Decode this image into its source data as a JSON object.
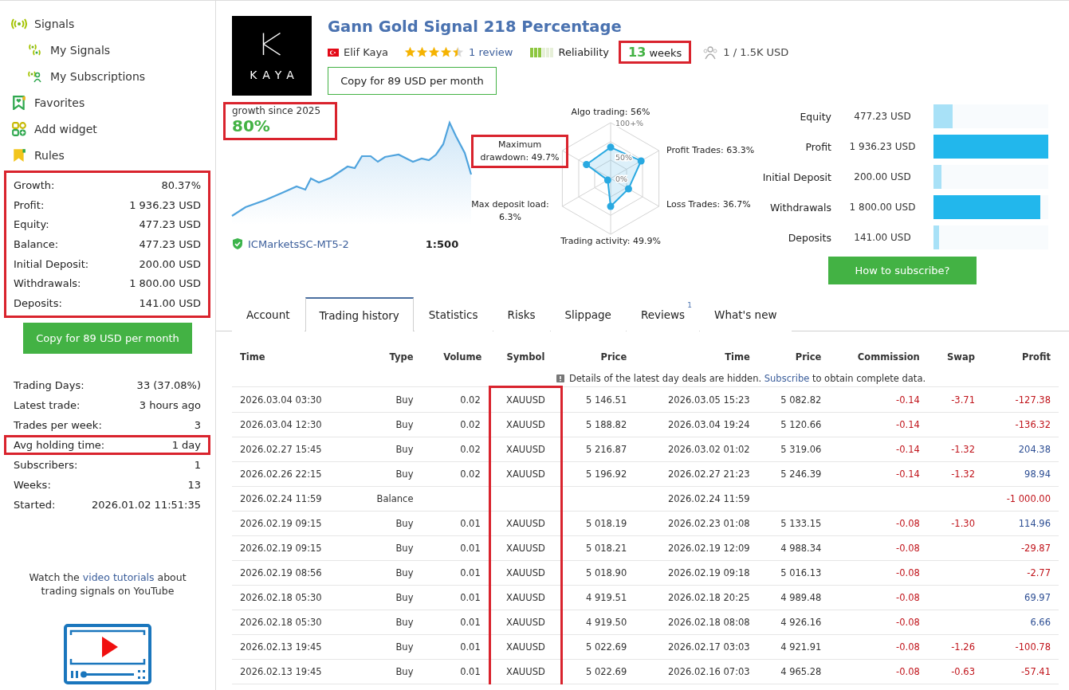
{
  "sidebar": {
    "nav": [
      {
        "label": "Signals",
        "children": [
          {
            "label": "My Signals"
          },
          {
            "label": "My Subscriptions"
          }
        ]
      },
      {
        "label": "Favorites"
      },
      {
        "label": "Add widget"
      },
      {
        "label": "Rules"
      }
    ],
    "stats_highlighted": true,
    "stats": [
      {
        "label": "Growth:",
        "value": "80.37%"
      },
      {
        "label": "Profit:",
        "value": "1 936.23 USD"
      },
      {
        "label": "Equity:",
        "value": "477.23 USD"
      },
      {
        "label": "Balance:",
        "value": "477.23 USD"
      },
      {
        "label": "Initial Deposit:",
        "value": "200.00 USD"
      },
      {
        "label": "Withdrawals:",
        "value": "1 800.00 USD"
      },
      {
        "label": "Deposits:",
        "value": "141.00 USD"
      }
    ],
    "copy_button": "Copy for 89 USD per month",
    "info": [
      {
        "label": "Trading Days:",
        "value": "33 (37.08%)",
        "highlighted": false
      },
      {
        "label": "Latest trade:",
        "value": "3 hours ago",
        "highlighted": false
      },
      {
        "label": "Trades per week:",
        "value": "3",
        "highlighted": false
      },
      {
        "label": "Avg holding time:",
        "value": "1 day",
        "highlighted": true
      },
      {
        "label": "Subscribers:",
        "value": "1",
        "highlighted": false
      },
      {
        "label": "Weeks:",
        "value": "13",
        "highlighted": false
      },
      {
        "label": "Started:",
        "value": "2026.01.02 11:51:35",
        "highlighted": false
      }
    ],
    "tutorial": {
      "before": "Watch the ",
      "link": "video tutorials",
      "after": " about trading signals on YouTube"
    }
  },
  "header": {
    "logo_text": "KAYA",
    "title": "Gann Gold Signal 218 Percentage",
    "author": "Elif Kaya",
    "stars": 4.5,
    "reviews": "1 review",
    "reliability": {
      "label": "Reliability",
      "level": 0.5
    },
    "weeks": {
      "value": "13",
      "unit": "weeks",
      "highlighted": true
    },
    "subscribers": "1 / 1.5K USD",
    "copy_button": "Copy for 89 USD per month"
  },
  "growth": {
    "label": "growth since 2025",
    "value": "80%",
    "highlighted": true
  },
  "broker": "ICMarketsSC-MT5-2",
  "leverage": "1:500",
  "radar": {
    "ticks": [
      "100+%",
      "50%",
      "0%"
    ],
    "axes": [
      {
        "label": "Algo trading: 56%",
        "highlighted": false
      },
      {
        "label": "Maximum drawdown: 49.7%",
        "highlighted": true
      },
      {
        "label": "Profit Trades: 63.3%",
        "highlighted": false
      },
      {
        "label": "Max deposit load: 6.3%",
        "highlighted": false
      },
      {
        "label": "Loss Trades: 36.7%",
        "highlighted": false
      },
      {
        "label": "Trading activity: 49.9%",
        "highlighted": false
      }
    ]
  },
  "balance_bars": [
    {
      "label": "Equity",
      "value": "477.23 USD",
      "level": 0.17,
      "color": "#a8e1f7"
    },
    {
      "label": "Profit",
      "value": "1 936.23 USD",
      "level": 1,
      "color": "#22b7ec"
    },
    {
      "label": "Initial Deposit",
      "value": "200.00 USD",
      "level": 0.07,
      "color": "#a8e1f7"
    },
    {
      "label": "Withdrawals",
      "value": "1 800.00 USD",
      "level": 0.93,
      "color": "#22b7ec"
    },
    {
      "label": "Deposits",
      "value": "141.00 USD",
      "level": 0.05,
      "color": "#a8e1f7"
    }
  ],
  "subscribe_button": "How to subscribe?",
  "tabs": [
    {
      "label": "Account",
      "selected": false
    },
    {
      "label": "Trading history",
      "selected": true
    },
    {
      "label": "Statistics",
      "selected": false
    },
    {
      "label": "Risks",
      "selected": false
    },
    {
      "label": "Slippage",
      "selected": false
    },
    {
      "label": "Reviews",
      "selected": false,
      "badge": "1"
    },
    {
      "label": "What's new",
      "selected": false
    }
  ],
  "table": {
    "columns": [
      "Time",
      "Type",
      "Volume",
      "Symbol",
      "Price",
      "Time",
      "Price",
      "Commission",
      "Swap",
      "Profit"
    ],
    "symbol_highlighted": true,
    "notice": {
      "before": "Details of the latest day deals are hidden. ",
      "link": "Subscribe",
      "after": " to obtain complete data."
    },
    "rows": [
      {
        "cells": [
          "2026.03.04 03:30",
          "Buy",
          "0.02",
          "XAUUSD",
          "5 146.51",
          "2026.03.05 15:23",
          "5 082.82",
          "-0.14",
          "-3.71",
          "-127.38"
        ],
        "profit_negative": true
      },
      {
        "cells": [
          "2026.03.04 12:30",
          "Buy",
          "0.02",
          "XAUUSD",
          "5 188.82",
          "2026.03.04 19:24",
          "5 120.66",
          "-0.14",
          "",
          "-136.32"
        ],
        "profit_negative": true
      },
      {
        "cells": [
          "2026.02.27 15:45",
          "Buy",
          "0.02",
          "XAUUSD",
          "5 216.87",
          "2026.03.02 01:02",
          "5 319.06",
          "-0.14",
          "-1.32",
          "204.38"
        ],
        "profit_negative": false
      },
      {
        "cells": [
          "2026.02.26 22:15",
          "Buy",
          "0.02",
          "XAUUSD",
          "5 196.92",
          "2026.02.27 21:23",
          "5 246.39",
          "-0.14",
          "-1.32",
          "98.94"
        ],
        "profit_negative": false
      },
      {
        "cells": [
          "2026.02.24 11:59",
          "Balance",
          "",
          "",
          "",
          "2026.02.24 11:59",
          "",
          "",
          "",
          "-1 000.00"
        ],
        "profit_negative": true
      },
      {
        "cells": [
          "2026.02.19 09:15",
          "Buy",
          "0.01",
          "XAUUSD",
          "5 018.19",
          "2026.02.23 01:08",
          "5 133.15",
          "-0.08",
          "-1.30",
          "114.96"
        ],
        "profit_negative": false
      },
      {
        "cells": [
          "2026.02.19 09:15",
          "Buy",
          "0.01",
          "XAUUSD",
          "5 018.21",
          "2026.02.19 12:09",
          "4 988.34",
          "-0.08",
          "",
          "-29.87"
        ],
        "profit_negative": true
      },
      {
        "cells": [
          "2026.02.19 08:56",
          "Buy",
          "0.01",
          "XAUUSD",
          "5 018.90",
          "2026.02.19 09:18",
          "5 016.13",
          "-0.08",
          "",
          "-2.77"
        ],
        "profit_negative": true
      },
      {
        "cells": [
          "2026.02.18 05:30",
          "Buy",
          "0.01",
          "XAUUSD",
          "4 919.51",
          "2026.02.18 20:25",
          "4 989.48",
          "-0.08",
          "",
          "69.97"
        ],
        "profit_negative": false
      },
      {
        "cells": [
          "2026.02.18 05:30",
          "Buy",
          "0.01",
          "XAUUSD",
          "4 919.50",
          "2026.02.18 08:08",
          "4 926.16",
          "-0.08",
          "",
          "6.66"
        ],
        "profit_negative": false
      },
      {
        "cells": [
          "2026.02.13 19:45",
          "Buy",
          "0.01",
          "XAUUSD",
          "5 022.69",
          "2026.02.17 03:03",
          "4 921.91",
          "-0.08",
          "-1.26",
          "-100.78"
        ],
        "profit_negative": true
      },
      {
        "cells": [
          "2026.02.13 19:45",
          "Buy",
          "0.01",
          "XAUUSD",
          "5 022.69",
          "2026.02.16 07:03",
          "4 965.28",
          "-0.08",
          "-0.63",
          "-57.41"
        ],
        "profit_negative": true
      }
    ]
  }
}
